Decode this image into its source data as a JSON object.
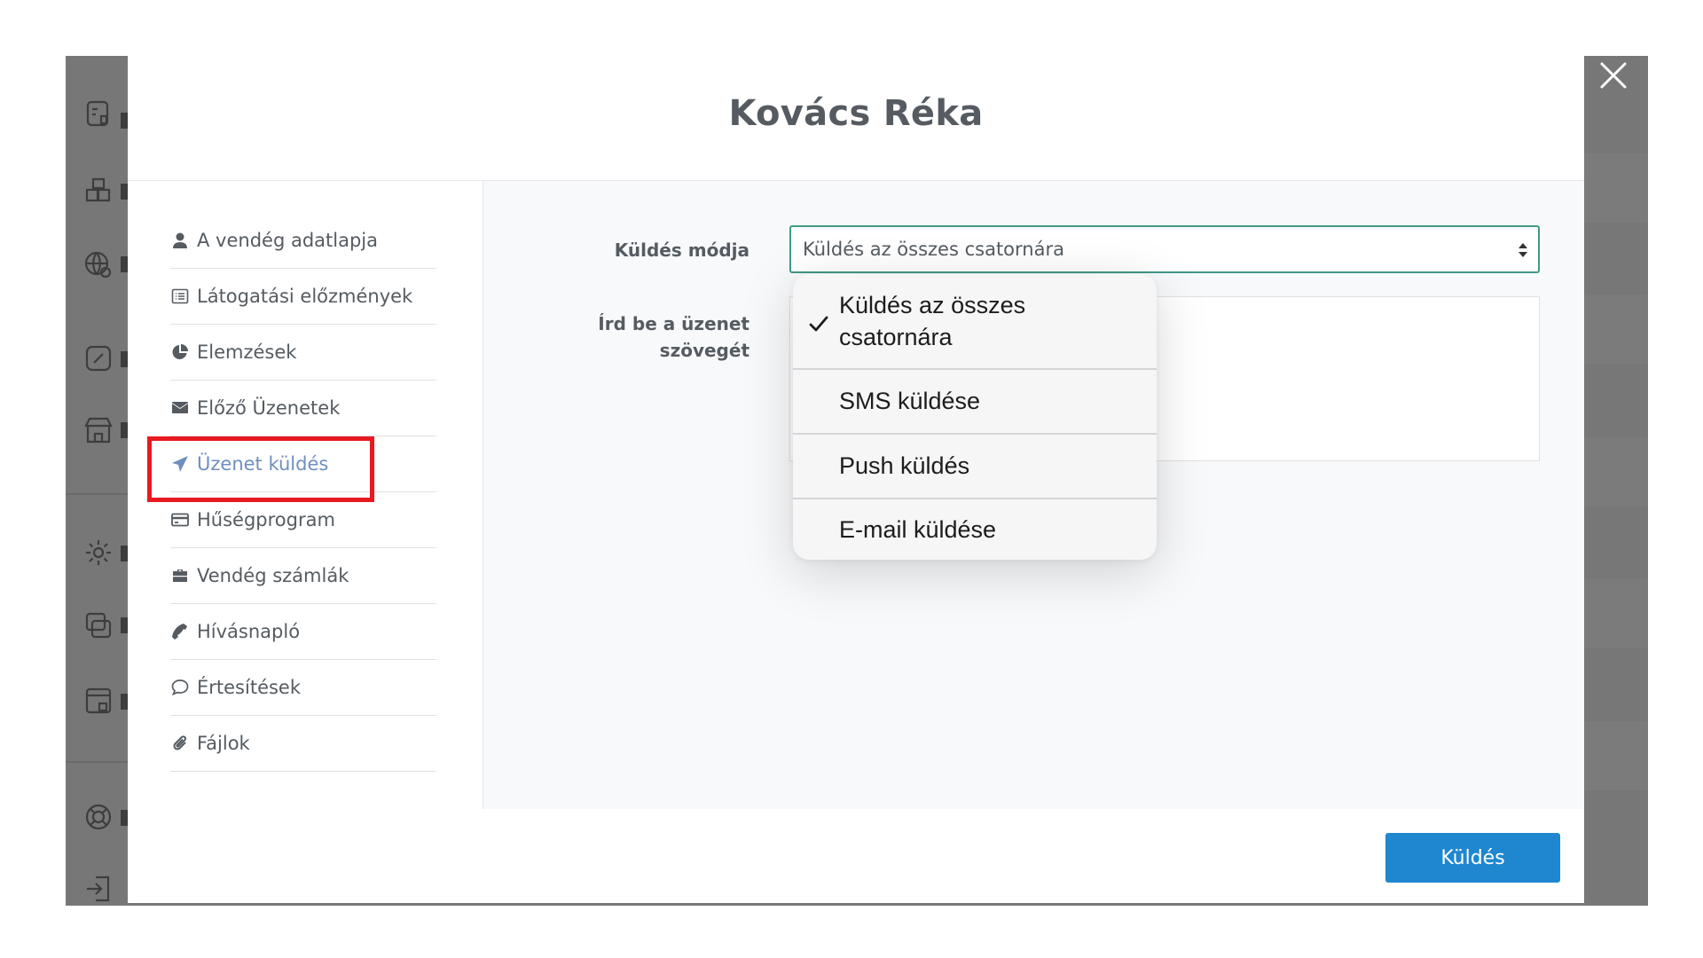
{
  "modal": {
    "title": "Kovács Réka"
  },
  "nav": {
    "items": [
      {
        "label": "A vendég adatlapja",
        "icon": "user-icon"
      },
      {
        "label": "Látogatási előzmények",
        "icon": "list-icon"
      },
      {
        "label": "Elemzések",
        "icon": "pie-chart-icon"
      },
      {
        "label": "Előző Üzenetek",
        "icon": "envelope-icon"
      },
      {
        "label": "Üzenet küldés",
        "icon": "paper-plane-icon",
        "active": true
      },
      {
        "label": "Hűségprogram",
        "icon": "credit-card-icon"
      },
      {
        "label": "Vendég számlák",
        "icon": "briefcase-icon"
      },
      {
        "label": "Hívásnapló",
        "icon": "phone-icon"
      },
      {
        "label": "Értesítések",
        "icon": "speech-bubble-icon"
      },
      {
        "label": "Fájlok",
        "icon": "paperclip-icon"
      }
    ]
  },
  "form": {
    "mode_label": "Küldés módja",
    "message_label_line1": "Írd be a üzenet",
    "message_label_line2": "szövegét",
    "selected_mode": "Küldés az összes csatornára",
    "message_value": ""
  },
  "dropdown": {
    "options": [
      {
        "label_line1": "Küldés az összes",
        "label_line2": "csatornára",
        "checked": true
      },
      {
        "label": "SMS küldése"
      },
      {
        "label": "Push küldés"
      },
      {
        "label": "E-mail küldése"
      }
    ]
  },
  "footer": {
    "send_label": "Küldés"
  },
  "colors": {
    "accent_blue": "#1f87cf",
    "active_nav": "#6f8fbf",
    "select_border": "#3f9a86",
    "highlight_red": "#e8191f",
    "overlay_gray": "#777777"
  }
}
